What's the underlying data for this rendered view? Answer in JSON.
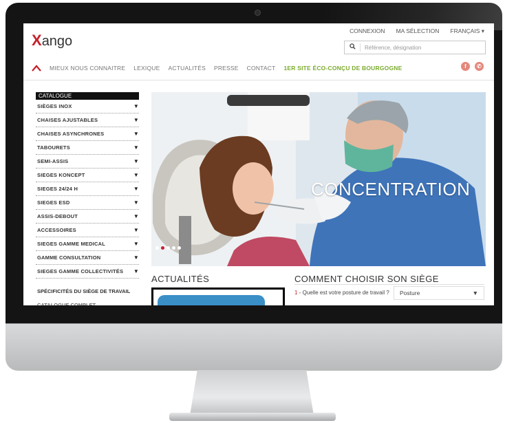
{
  "site": {
    "logo_prefix": "X",
    "logo_text": "ango",
    "top_links": [
      "CONNEXION",
      "MA SÉLECTION",
      "FRANÇAIS ▾"
    ],
    "search_placeholder": "Référence, désignation",
    "search_icon": "search-icon"
  },
  "nav": {
    "home_icon": "home-icon",
    "items": [
      "MIEUX NOUS CONNAITRE",
      "LEXIQUE",
      "ACTUALITÉS",
      "PRESSE",
      "CONTACT"
    ],
    "eco_label": "1ER SITE ÉCO-CONÇU DE BOURGOGNE",
    "social": [
      "f",
      "✆"
    ]
  },
  "catalog": {
    "heading": "CATALOGUE",
    "items": [
      "SIÈGES INOX",
      "CHAISES AJUSTABLES",
      "CHAISES ASYNCHRONES",
      "TABOURETS",
      "SEMI-ASSIS",
      "SIEGES KONCEPT",
      "SIEGES 24/24 H",
      "SIEGES ESD",
      "ASSIS-DEBOUT",
      "ACCESSOIRES",
      "SIEGES GAMME MEDICAL",
      "GAMME CONSULTATION",
      "SIEGES GAMME COLLECTIVITÉS"
    ],
    "extra": [
      "SPÉCIFICITÉS DU SIÈGE DE TRAVAIL",
      "CATALOGUE COMPLET"
    ]
  },
  "hero": {
    "caption": "CONCENTRATION",
    "slide_count": 5,
    "active_slide": 2
  },
  "news": {
    "title": "ACTUALITÉS"
  },
  "guide": {
    "title": "COMMENT CHOISIR SON SIÈGE",
    "question_number": "1",
    "question_text": " - Quelle est votre posture de travail ?",
    "select_value": "Posture"
  },
  "colors": {
    "brand_red": "#c6202b",
    "eco_green": "#7aab2b"
  }
}
